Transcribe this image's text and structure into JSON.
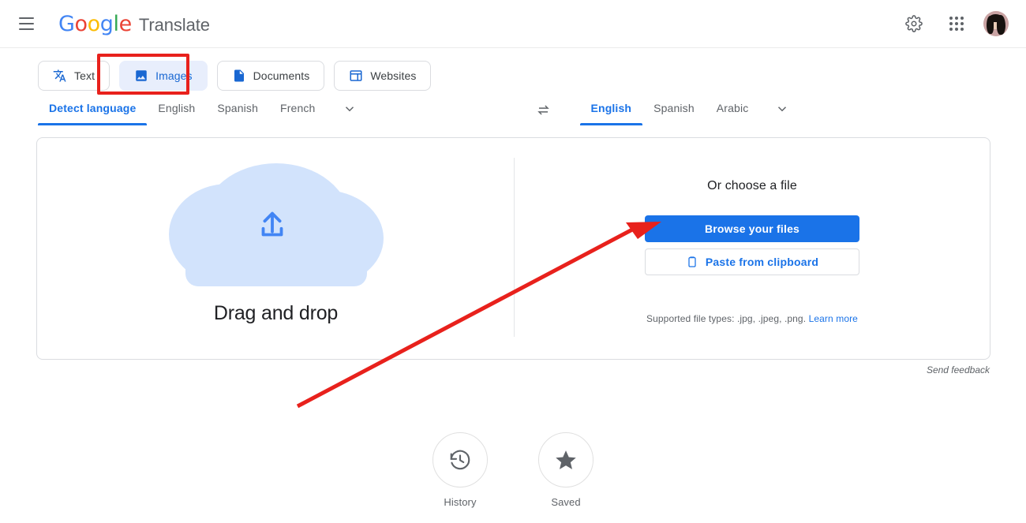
{
  "header": {
    "menu_icon": "hamburger-menu-icon",
    "logo_text": "Google",
    "product_name": "Translate",
    "settings_icon": "gear-icon",
    "apps_icon": "apps-grid-icon",
    "avatar_icon": "user-avatar"
  },
  "tabs": [
    {
      "label": "Text",
      "icon": "translate-icon",
      "active": false
    },
    {
      "label": "Images",
      "icon": "image-icon",
      "active": true
    },
    {
      "label": "Documents",
      "icon": "document-icon",
      "active": false
    },
    {
      "label": "Websites",
      "icon": "website-icon",
      "active": false
    }
  ],
  "source_languages": {
    "items": [
      {
        "label": "Detect language",
        "active": true
      },
      {
        "label": "English",
        "active": false
      },
      {
        "label": "Spanish",
        "active": false
      },
      {
        "label": "French",
        "active": false
      }
    ],
    "more_icon": "chevron-down-icon"
  },
  "swap_icon": "swap-languages-icon",
  "target_languages": {
    "items": [
      {
        "label": "English",
        "active": true
      },
      {
        "label": "Spanish",
        "active": false
      },
      {
        "label": "Arabic",
        "active": false
      }
    ],
    "more_icon": "chevron-down-icon"
  },
  "upload_panel": {
    "cloud_icon": "upload-cloud-icon",
    "drag_and_drop_label": "Drag and drop",
    "choose_file_title": "Or choose a file",
    "browse_button": "Browse your files",
    "paste_button": "Paste from clipboard",
    "paste_icon": "clipboard-icon",
    "supported_types_text": "Supported file types: .jpg, .jpeg, .png.",
    "learn_more_link": "Learn more"
  },
  "send_feedback": "Send feedback",
  "bottom_actions": [
    {
      "label": "History",
      "icon": "history-clock-icon"
    },
    {
      "label": "Saved",
      "icon": "star-icon"
    }
  ],
  "annotations": {
    "highlight_target": "Images",
    "arrow_target": "Browse your files",
    "color": "#e8211c"
  },
  "colors": {
    "google_blue": "#4285f4",
    "google_red": "#ea4335",
    "google_yellow": "#fbbc05",
    "google_green": "#34a853",
    "accent_blue": "#1a73e8",
    "cloud_blue": "#d2e3fc",
    "annotation_red": "#e8211c"
  }
}
